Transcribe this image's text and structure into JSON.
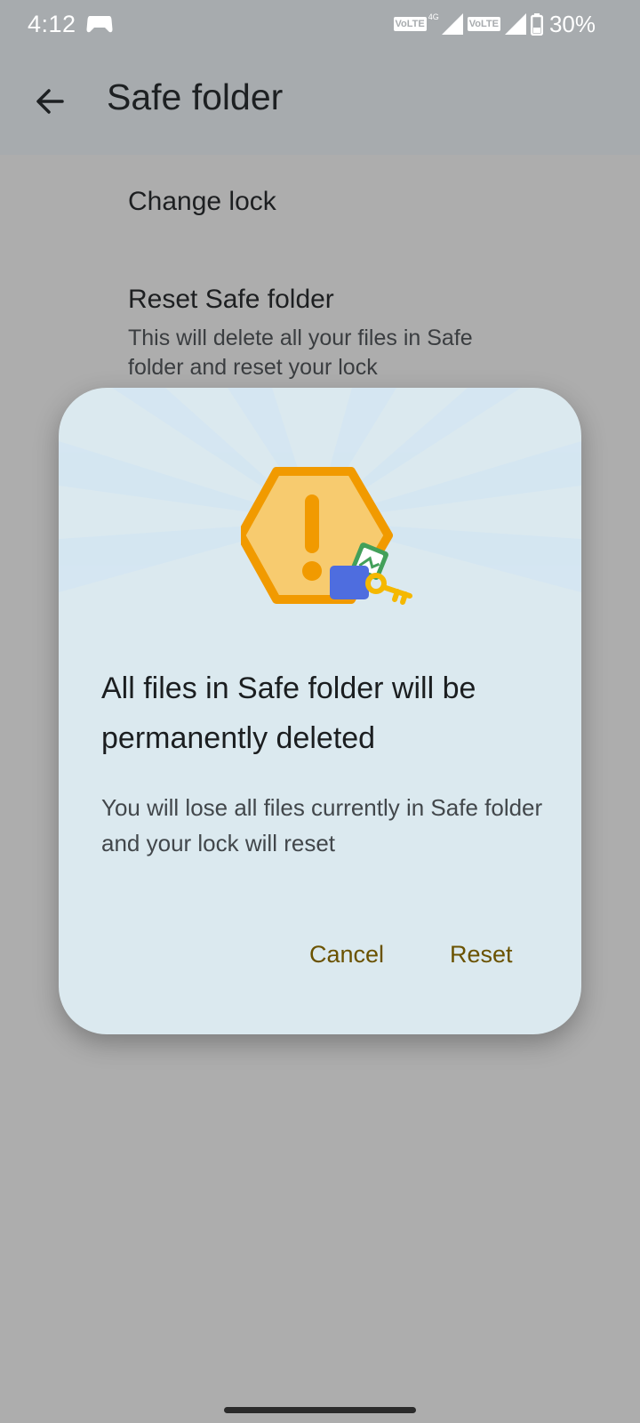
{
  "status_bar": {
    "time": "4:12",
    "network1": "VoLTE",
    "network1_type": "4G",
    "network2": "VoLTE",
    "battery": "30%",
    "notification_icon": "game-controller-icon"
  },
  "app_bar": {
    "back_icon": "arrow-back-icon",
    "title": "Safe folder"
  },
  "settings": {
    "change_lock": {
      "title": "Change lock"
    },
    "reset": {
      "title": "Reset Safe folder",
      "subtitle": "This will delete all your files in Safe folder and reset your lock"
    }
  },
  "dialog": {
    "illustration_icon": "warning-folder-key-icon",
    "title": "All files in Safe folder will be permanently deleted",
    "message": "You will lose all files currently in Safe folder and your lock will reset",
    "cancel_label": "Cancel",
    "reset_label": "Reset"
  },
  "colors": {
    "accent_button": "#6a5200",
    "dialog_bg": "#dbe9ef",
    "warning_orange": "#f19a00",
    "warning_fill": "#f7cb6f"
  }
}
